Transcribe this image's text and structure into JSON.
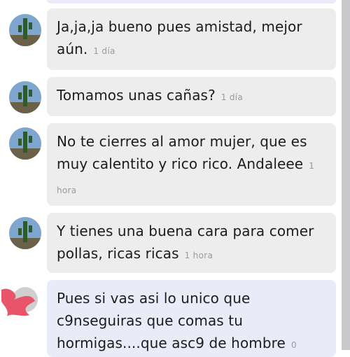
{
  "messages": [
    {
      "text": "Ja,ja,ja bueno pues amistad, mejor aún.",
      "time": "1 día"
    },
    {
      "text": "Tomamos unas cañas?",
      "time": "1 día"
    },
    {
      "text": "No te cierres al amor mujer, que es muy calentito y rico rico. Andaleee",
      "time": "1 hora"
    },
    {
      "text": "Y tienes una buena cara para comer pollas, ricas ricas",
      "time": "1 hora"
    },
    {
      "text": "Pues si vas asi lo unico que c9nseguiras que comas tu hormigas....que asc9 de hombre",
      "time": "0"
    }
  ],
  "avatar_icon": "cactus-profile-photo",
  "own_avatar_icon": "redacted-avatar",
  "colors": {
    "incoming_bubble": "#ededed",
    "own_bubble": "#e9ecf8",
    "redaction": "#e8546a"
  }
}
